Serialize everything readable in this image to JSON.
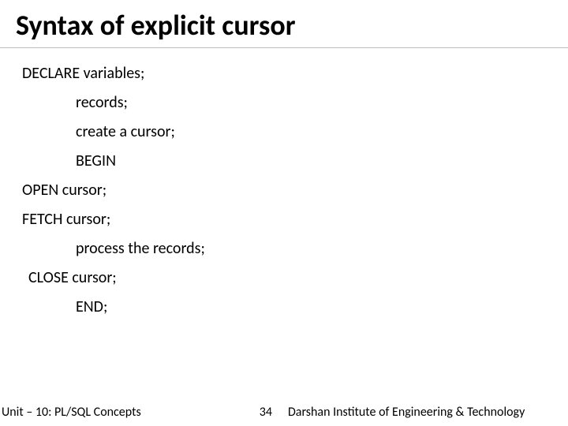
{
  "title": "Syntax of explicit cursor",
  "lines": {
    "l1": "DECLARE variables;",
    "l2": "records;",
    "l3": "create a cursor;",
    "l4": "BEGIN",
    "l5": "OPEN cursor;",
    "l6": "FETCH cursor;",
    "l7": "process the records;",
    "l8": "CLOSE cursor;",
    "l9": "END;"
  },
  "footer": {
    "unit": "Unit – 10: PL/SQL Concepts",
    "page": "34",
    "org": "Darshan Institute of Engineering & Technology"
  }
}
